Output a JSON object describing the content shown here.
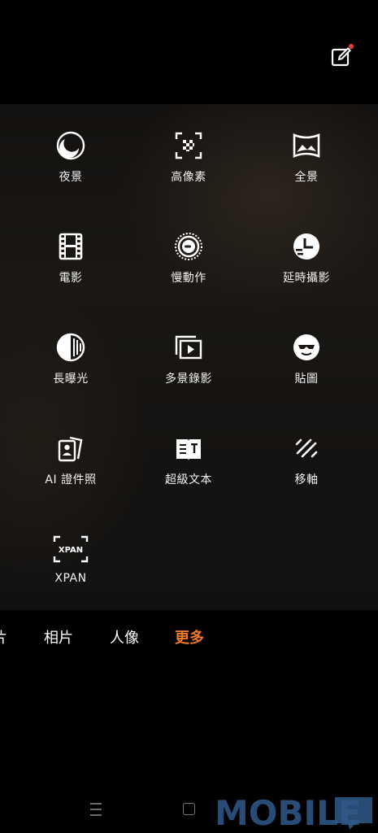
{
  "topbar": {
    "edit_icon": "edit-icon",
    "notification_dot_color": "#e53935"
  },
  "modes": [
    {
      "label": "夜景",
      "icon": "night-icon"
    },
    {
      "label": "高像素",
      "icon": "high-pixel-icon"
    },
    {
      "label": "全景",
      "icon": "panorama-icon"
    },
    {
      "label": "電影",
      "icon": "film-icon"
    },
    {
      "label": "慢動作",
      "icon": "slow-motion-icon"
    },
    {
      "label": "延時攝影",
      "icon": "time-lapse-icon"
    },
    {
      "label": "長曝光",
      "icon": "long-exposure-icon"
    },
    {
      "label": "多景錄影",
      "icon": "multi-scene-video-icon"
    },
    {
      "label": "貼圖",
      "icon": "sticker-icon"
    },
    {
      "label": "AI 證件照",
      "icon": "id-photo-icon"
    },
    {
      "label": "超級文本",
      "icon": "super-text-icon"
    },
    {
      "label": "移軸",
      "icon": "tilt-shift-icon"
    },
    {
      "label": "XPAN",
      "icon": "xpan-icon"
    }
  ],
  "tabs": {
    "partial": "片",
    "items": [
      "相片",
      "人像",
      "更多"
    ],
    "active": "更多",
    "active_color": "#f07a2a"
  },
  "navbar": {
    "menu_icon": "menu-icon",
    "home_icon": "home-icon"
  },
  "watermark": {
    "text": "MOBILE"
  }
}
